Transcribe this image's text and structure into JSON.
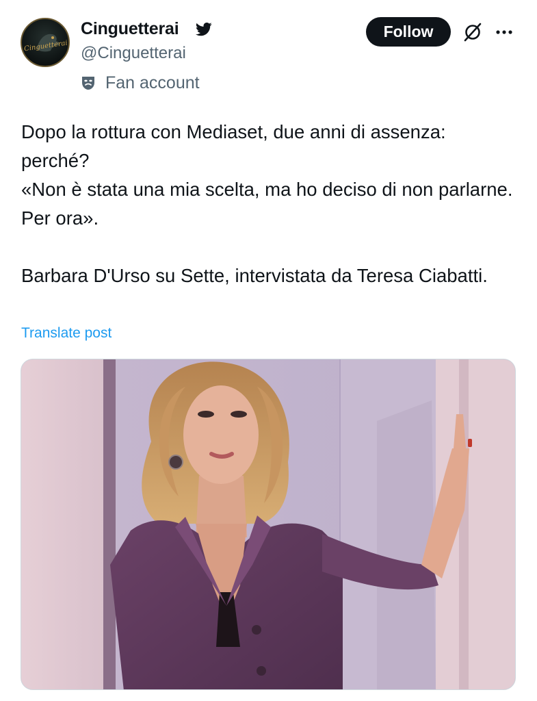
{
  "author": {
    "display_name": "Cinguetterai",
    "handle": "@Cinguetterai",
    "avatar_text": "Cinguetterai",
    "label": "Fan account",
    "badge_icon": "bird-icon",
    "label_icon": "theater-mask-icon"
  },
  "actions": {
    "follow_label": "Follow",
    "grok_icon": "grok-icon",
    "more_icon": "more-dots-icon"
  },
  "post": {
    "text": "Dopo la rottura con Mediaset, due anni di assenza: perché?\n«Non è stata una mia scelta, ma ho deciso di non parlarne. Per ora».\n\nBarbara D'Urso su Sette, intervistata da Teresa Ciabatti.",
    "translate_label": "Translate post"
  },
  "colors": {
    "text_primary": "#0f1419",
    "text_secondary": "#536471",
    "link": "#1d9bf0",
    "follow_bg": "#0f1419"
  }
}
